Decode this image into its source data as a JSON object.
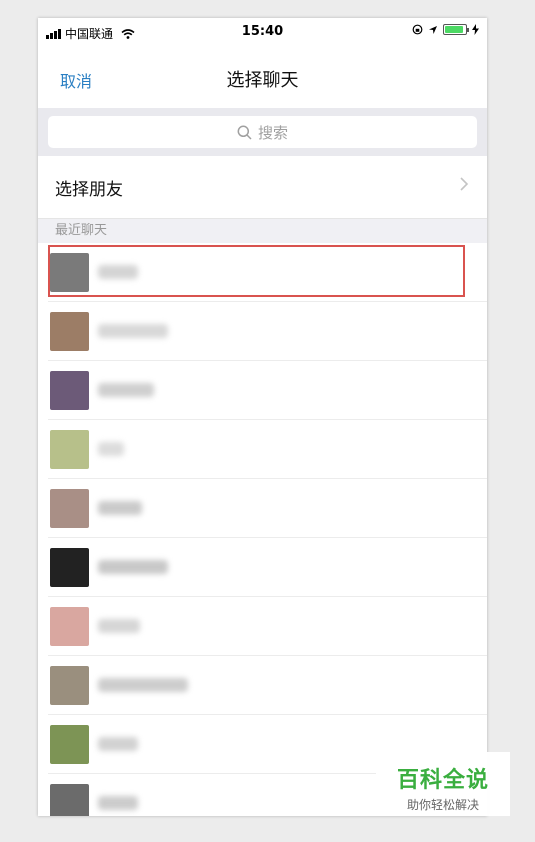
{
  "status_bar": {
    "carrier": "中国联通",
    "time": "15:40"
  },
  "nav": {
    "cancel_label": "取消",
    "title": "选择聊天"
  },
  "search": {
    "placeholder": "搜索"
  },
  "select_friends": {
    "label": "选择朋友"
  },
  "recent_section": {
    "label": "最近聊天"
  },
  "colors": {
    "accent": "#2a7fc3",
    "highlight": "#d9534f",
    "battery": "#4cd964"
  },
  "chats": [
    {
      "avatar": "#7a7a7a",
      "name_color": "#d4d4d4",
      "highlighted": true
    },
    {
      "avatar": "#9c7d66",
      "name_color": "#d8d8d8",
      "highlighted": false
    },
    {
      "avatar": "#6c5a78",
      "name_color": "#cfcfcf",
      "highlighted": false
    },
    {
      "avatar": "#b7c08a",
      "name_color": "#dcdcdc",
      "highlighted": false
    },
    {
      "avatar": "#a98f86",
      "name_color": "#cacaca",
      "highlighted": false
    },
    {
      "avatar": "#222222",
      "name_color": "#c8c8c8",
      "highlighted": false
    },
    {
      "avatar": "#d9a7a0",
      "name_color": "#d6d6d6",
      "highlighted": false
    },
    {
      "avatar": "#9a8f7e",
      "name_color": "#cdcdcd",
      "highlighted": false
    },
    {
      "avatar": "#7d9455",
      "name_color": "#d2d2d2",
      "highlighted": false
    },
    {
      "avatar": "#6b6b6b",
      "name_color": "#cccccc",
      "highlighted": false
    }
  ],
  "watermark": {
    "title": "百科全说",
    "subtitle": "助你轻松解决"
  }
}
